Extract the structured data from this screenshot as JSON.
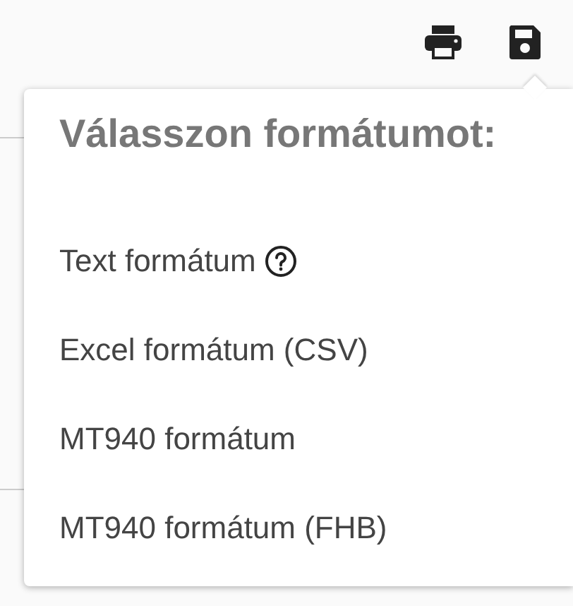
{
  "toolbar": {
    "buttons": [
      {
        "kind": "print"
      },
      {
        "kind": "save"
      }
    ]
  },
  "popover": {
    "title": "Válasszon formátumot:",
    "options": [
      {
        "label": "Text formátum",
        "help": true
      },
      {
        "label": "Excel formátum (CSV)",
        "help": false
      },
      {
        "label": "MT940 formátum",
        "help": false
      },
      {
        "label": "MT940 formátum (FHB)",
        "help": false
      }
    ]
  }
}
